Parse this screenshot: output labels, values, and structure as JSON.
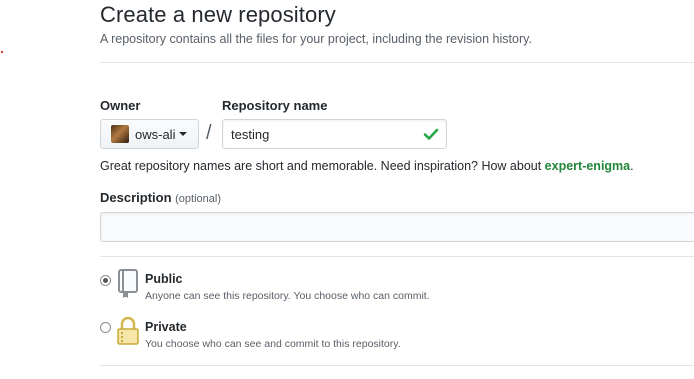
{
  "header": {
    "title": "Create a new repository",
    "subtitle": "A repository contains all the files for your project, including the revision history."
  },
  "owner": {
    "label": "Owner",
    "value": "ows-ali",
    "avatar_icon": "user-avatar"
  },
  "repo": {
    "separator": "/",
    "label": "Repository name",
    "value": "testing",
    "status_icon": "check-icon",
    "status_color": "#28a745"
  },
  "hint": {
    "text": "Great repository names are short and memorable. Need inspiration? How about ",
    "suggestion": "expert-enigma",
    "end": "."
  },
  "description": {
    "label": "Description",
    "optional": "(optional)",
    "value": ""
  },
  "visibility": {
    "selected": "public",
    "public": {
      "title": "Public",
      "desc": "Anyone can see this repository. You choose who can commit.",
      "icon": "repo-book-icon"
    },
    "private": {
      "title": "Private",
      "desc": "You choose who can see and commit to this repository.",
      "icon": "lock-icon"
    }
  }
}
